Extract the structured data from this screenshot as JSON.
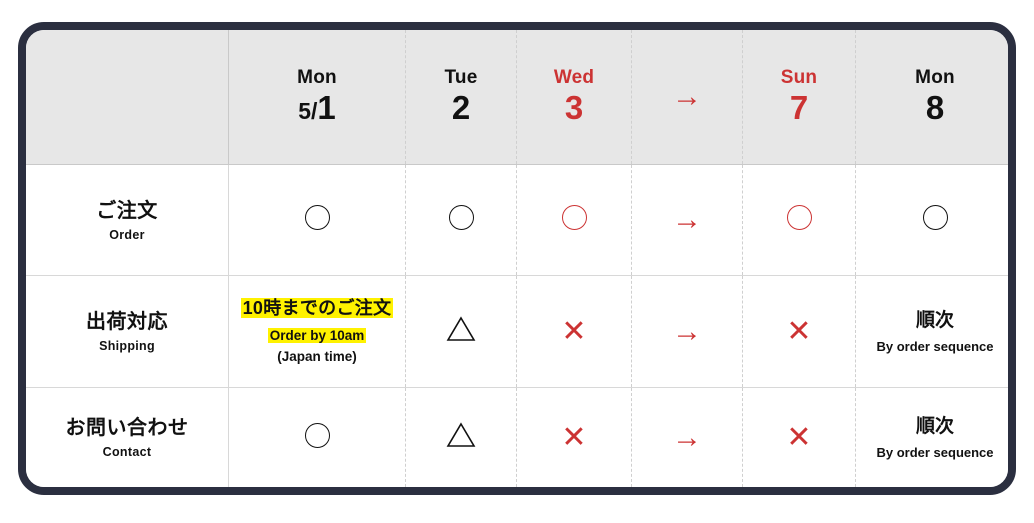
{
  "colors": {
    "frame": "#2B2F40",
    "header_bg": "#E7E7E7",
    "red": "#CC3333",
    "black": "#111111",
    "highlight": "#FFF200",
    "grid": "#D8D8D8"
  },
  "header": {
    "corner_label": "",
    "columns": [
      {
        "dow": "Mon",
        "day": "1",
        "month_prefix": "5/",
        "red": false,
        "arrow": false
      },
      {
        "dow": "Tue",
        "day": "2",
        "month_prefix": "",
        "red": false,
        "arrow": false
      },
      {
        "dow": "Wed",
        "day": "3",
        "month_prefix": "",
        "red": true,
        "arrow": false
      },
      {
        "dow": "",
        "day": "",
        "month_prefix": "",
        "red": true,
        "arrow": true,
        "arrow_glyph": "→"
      },
      {
        "dow": "Sun",
        "day": "7",
        "month_prefix": "",
        "red": true,
        "arrow": false
      },
      {
        "dow": "Mon",
        "day": "8",
        "month_prefix": "",
        "red": false,
        "arrow": false
      }
    ]
  },
  "rows": [
    {
      "label_ja": "ご注文",
      "label_en": "Order",
      "cells": [
        {
          "kind": "circle",
          "color": "black"
        },
        {
          "kind": "circle",
          "color": "black"
        },
        {
          "kind": "circle",
          "color": "red"
        },
        {
          "kind": "arrow",
          "color": "red",
          "glyph": "→"
        },
        {
          "kind": "circle",
          "color": "red"
        },
        {
          "kind": "circle",
          "color": "black"
        }
      ]
    },
    {
      "label_ja": "出荷対応",
      "label_en": "Shipping",
      "cells": [
        {
          "kind": "text",
          "line_ja": "10時までのご注文",
          "line_en": "Order by 10am",
          "line_note": "(Japan time)",
          "highlight_ja": true,
          "highlight_en": true,
          "highlight_note": false
        },
        {
          "kind": "triangle",
          "color": "black"
        },
        {
          "kind": "cross",
          "color": "red",
          "glyph": "✕"
        },
        {
          "kind": "arrow",
          "color": "red",
          "glyph": "→"
        },
        {
          "kind": "cross",
          "color": "red",
          "glyph": "✕"
        },
        {
          "kind": "sequence",
          "seq_ja": "順次",
          "seq_en": "By order sequence"
        }
      ]
    },
    {
      "label_ja": "お問い合わせ",
      "label_en": "Contact",
      "cells": [
        {
          "kind": "circle",
          "color": "black"
        },
        {
          "kind": "triangle",
          "color": "black"
        },
        {
          "kind": "cross",
          "color": "red",
          "glyph": "✕"
        },
        {
          "kind": "arrow",
          "color": "red",
          "glyph": "→"
        },
        {
          "kind": "cross",
          "color": "red",
          "glyph": "✕"
        },
        {
          "kind": "sequence",
          "seq_ja": "順次",
          "seq_en": "By order sequence"
        }
      ]
    }
  ]
}
